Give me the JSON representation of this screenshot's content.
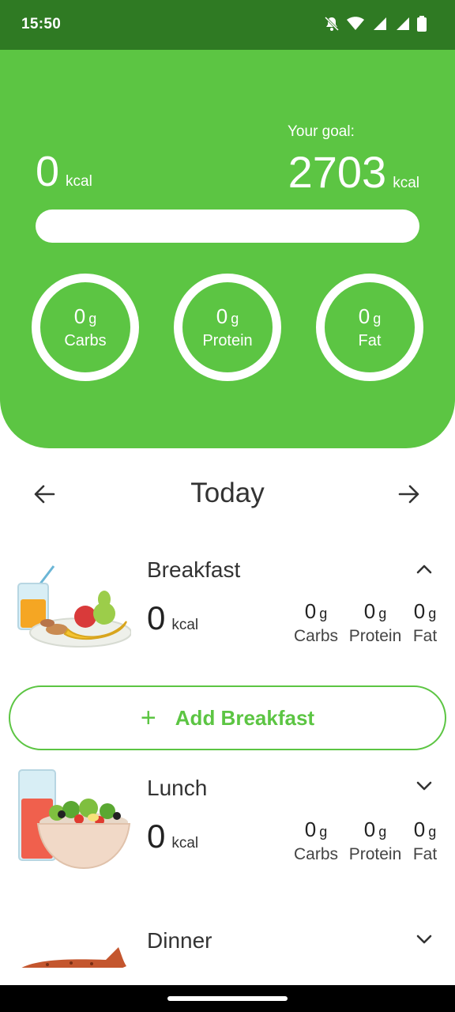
{
  "status_bar": {
    "time": "15:50",
    "icons": [
      "mute-bell-icon",
      "wifi-icon",
      "signal-icon",
      "signal-icon",
      "battery-icon"
    ]
  },
  "summary": {
    "consumed_value": "0",
    "consumed_unit": "kcal",
    "goal_label": "Your goal:",
    "goal_value": "2703",
    "goal_unit": "kcal",
    "progress_percent": 0,
    "macros": [
      {
        "value": "0",
        "unit": "g",
        "label": "Carbs"
      },
      {
        "value": "0",
        "unit": "g",
        "label": "Protein"
      },
      {
        "value": "0",
        "unit": "g",
        "label": "Fat"
      }
    ]
  },
  "day_nav": {
    "title": "Today",
    "prev_icon": "arrow-left-icon",
    "next_icon": "arrow-right-icon"
  },
  "meals": [
    {
      "name": "Breakfast",
      "kcal": "0",
      "unit": "kcal",
      "expanded": true,
      "macros": [
        {
          "value": "0",
          "unit": "g",
          "label": "Carbs"
        },
        {
          "value": "0",
          "unit": "g",
          "label": "Protein"
        },
        {
          "value": "0",
          "unit": "g",
          "label": "Fat"
        }
      ],
      "add_label": "Add Breakfast"
    },
    {
      "name": "Lunch",
      "kcal": "0",
      "unit": "kcal",
      "expanded": false,
      "macros": [
        {
          "value": "0",
          "unit": "g",
          "label": "Carbs"
        },
        {
          "value": "0",
          "unit": "g",
          "label": "Protein"
        },
        {
          "value": "0",
          "unit": "g",
          "label": "Fat"
        }
      ]
    },
    {
      "name": "Dinner",
      "expanded": false
    }
  ],
  "colors": {
    "brand_green": "#5cc543",
    "status_dark_green": "#2f7a23"
  }
}
